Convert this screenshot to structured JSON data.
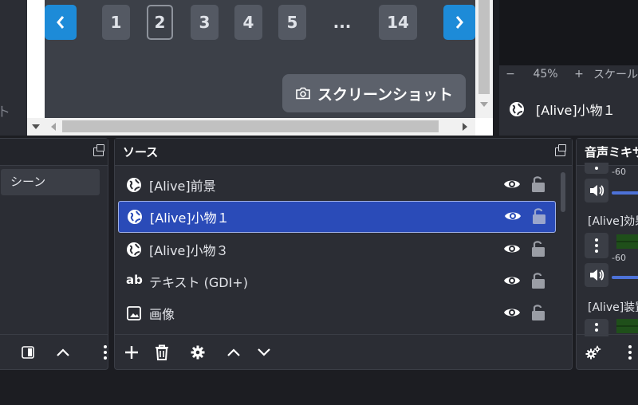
{
  "browser": {
    "pager": {
      "prev": "‹",
      "pages": [
        "1",
        "2",
        "3",
        "4",
        "5"
      ],
      "ellipsis": "...",
      "last": "14",
      "next": "›"
    },
    "screenshot_button": "スクリーンショット"
  },
  "left_strip": {
    "cut_text": "ト"
  },
  "preview": {
    "zoom_minus": "−",
    "zoom_value": "45%",
    "zoom_plus": "+",
    "scale_label": "スケール"
  },
  "properties": {
    "source_name": "[Alive]小物１"
  },
  "scenes": {
    "items": [
      "シーン"
    ]
  },
  "sources": {
    "title": "ソース",
    "items": [
      {
        "name": "[Alive]前景",
        "icon": "globe-icon",
        "selected": false
      },
      {
        "name": "[Alive]小物１",
        "icon": "globe-icon",
        "selected": true
      },
      {
        "name": "[Alive]小物３",
        "icon": "globe-icon",
        "selected": false
      },
      {
        "name": "テキスト (GDI+)",
        "icon": "text-ab-icon",
        "selected": false
      },
      {
        "name": "画像",
        "icon": "image-icon",
        "selected": false
      }
    ]
  },
  "mixer": {
    "title": "音声ミキサ",
    "tracks": [
      {
        "name": "[Alive]効果"
      },
      {
        "name": "[Alive]装置"
      }
    ],
    "db_label": "-60"
  },
  "colors": {
    "accent": "#1d8bd8",
    "selected": "#2a4bb8",
    "panel": "#2b2d34",
    "meter": "#1f4f1a"
  }
}
